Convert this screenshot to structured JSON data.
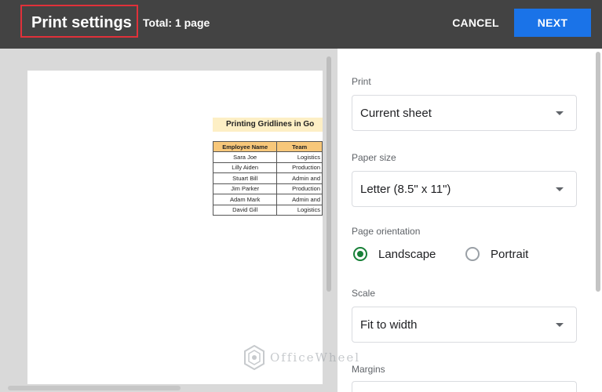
{
  "header": {
    "title": "Print settings",
    "total": "Total: 1 page",
    "cancel_label": "CANCEL",
    "next_label": "NEXT",
    "accent_color": "#1a73e8",
    "highlight_color": "#e0313a"
  },
  "preview": {
    "sheet_title": "Printing Gridlines in Go",
    "columns": [
      "Employee Name",
      "Team"
    ],
    "rows": [
      [
        "Sara Joe",
        "Logistics"
      ],
      [
        "Lilly Aiden",
        "Production"
      ],
      [
        "Stuart Bill",
        "Admin and"
      ],
      [
        "Jim Parker",
        "Production"
      ],
      [
        "Adam Mark",
        "Admin and"
      ],
      [
        "David Gill",
        "Logistics"
      ]
    ]
  },
  "settings": {
    "print_label": "Print",
    "print_value": "Current sheet",
    "paper_label": "Paper size",
    "paper_value": "Letter (8.5\" x 11\")",
    "orientation_label": "Page orientation",
    "orientation_options": [
      "Landscape",
      "Portrait"
    ],
    "orientation_selected": "Landscape",
    "scale_label": "Scale",
    "scale_value": "Fit to width",
    "margins_label": "Margins"
  },
  "watermark": {
    "text": "OfficeWheel",
    "icon": "officewheel-logo-icon"
  }
}
